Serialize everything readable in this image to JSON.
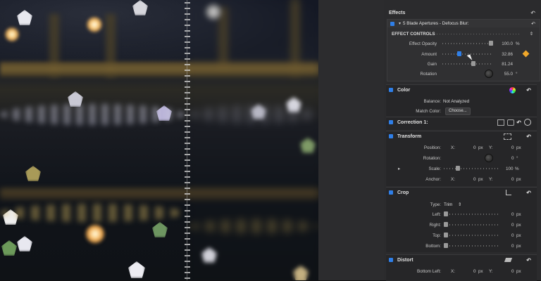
{
  "effects": {
    "title": "Effects",
    "effect_name": "5 Blade Apertures - Defocus Blur:",
    "controls_label": "EFFECT CONTROLS",
    "params": [
      {
        "label": "Effect Opacity",
        "value": "100.0",
        "unit": "%"
      },
      {
        "label": "Amount",
        "value": "32.86",
        "unit": ""
      },
      {
        "label": "Gain",
        "value": "81.24",
        "unit": ""
      },
      {
        "label": "Rotation",
        "value": "55.0",
        "unit": "°"
      }
    ]
  },
  "color": {
    "title": "Color",
    "balance_label": "Balance:",
    "balance_value": "Not Analyzed",
    "match_label": "Match Color:",
    "match_button": "Choose..."
  },
  "correction": {
    "title": "Correction 1:"
  },
  "transform": {
    "title": "Transform",
    "position_label": "Position:",
    "rotation_label": "Rotation:",
    "rotation_value": "0",
    "rotation_unit": "°",
    "scale_label": "Scale:",
    "scale_value": "100",
    "scale_unit": "%",
    "anchor_label": "Anchor:",
    "x_label": "X:",
    "y_label": "Y:",
    "zero": "0",
    "px": "px"
  },
  "crop": {
    "title": "Crop",
    "type_label": "Type:",
    "type_value": "Trim",
    "left_label": "Left:",
    "right_label": "Right:",
    "top_label": "Top:",
    "bottom_label": "Bottom:",
    "zero": "0",
    "px": "px"
  },
  "distort": {
    "title": "Distort",
    "bottom_left_label": "Bottom Left:",
    "x_label": "X:",
    "y_label": "Y:",
    "zero": "0",
    "px": "px"
  },
  "icons": {
    "reset": "↶",
    "expand": "▾",
    "sort": "⇕",
    "arrow_right": "▸"
  }
}
